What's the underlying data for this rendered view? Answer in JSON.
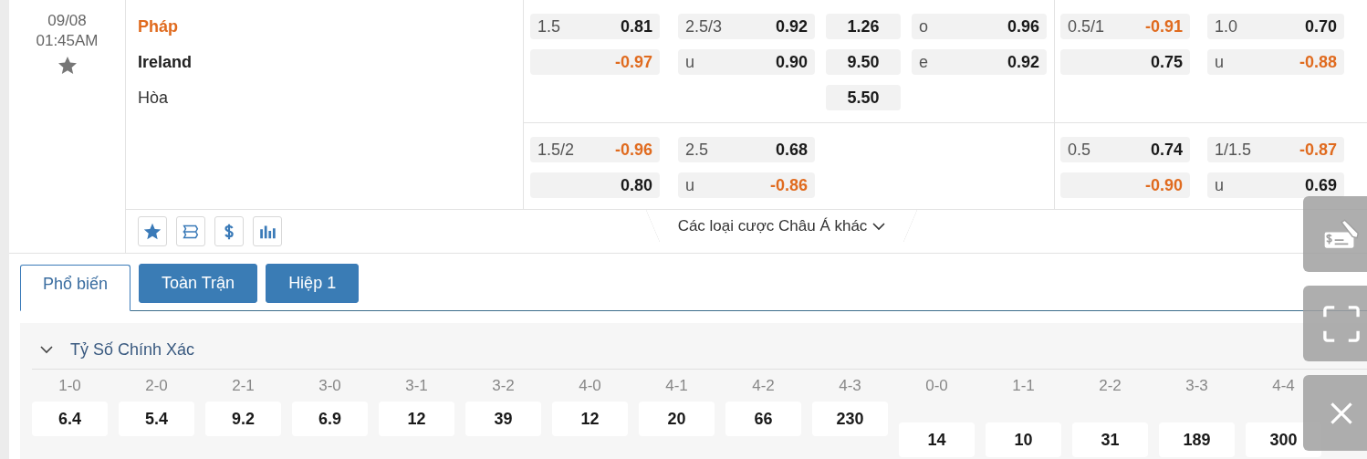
{
  "match": {
    "date": "09/08",
    "time": "01:45AM",
    "favorite": false,
    "teams": [
      {
        "name": "Pháp",
        "favored": true
      },
      {
        "name": "Ireland",
        "favored": false
      }
    ],
    "draw_label": "Hòa"
  },
  "odds_groups": [
    {
      "rows": [
        {
          "columns": [
            [
              {
                "label": "1.5",
                "value": "0.81",
                "negative": false
              },
              {
                "value": "-0.97",
                "negative": true
              }
            ],
            [
              {
                "label": "2.5/3",
                "value": "0.92",
                "negative": false
              },
              {
                "label": "u",
                "value": "0.90",
                "negative": false
              }
            ],
            [
              {
                "value": "1.26",
                "negative": false
              },
              {
                "value": "9.50",
                "negative": false
              },
              {
                "value": "5.50",
                "negative": false
              }
            ],
            [
              {
                "label": "o",
                "value": "0.96",
                "negative": false
              },
              {
                "label": "e",
                "value": "0.92",
                "negative": false
              }
            ]
          ]
        },
        {
          "columns": [
            [
              {
                "label": "1.5/2",
                "value": "-0.96",
                "negative": true
              },
              {
                "value": "0.80",
                "negative": false
              }
            ],
            [
              {
                "label": "2.5",
                "value": "0.68",
                "negative": false
              },
              {
                "label": "u",
                "value": "-0.86",
                "negative": true
              }
            ]
          ]
        }
      ]
    },
    {
      "rows": [
        {
          "columns": [
            [
              {
                "label": "0.5/1",
                "value": "-0.91",
                "negative": true
              },
              {
                "value": "0.75",
                "negative": false
              }
            ],
            [
              {
                "label": "1.0",
                "value": "0.70",
                "negative": false
              },
              {
                "label": "u",
                "value": "-0.88",
                "negative": true
              }
            ]
          ]
        },
        {
          "columns": [
            [
              {
                "label": "0.5",
                "value": "0.74",
                "negative": false
              },
              {
                "value": "-0.90",
                "negative": true
              }
            ],
            [
              {
                "label": "1/1.5",
                "value": "-0.87",
                "negative": true
              },
              {
                "label": "u",
                "value": "0.69",
                "negative": false
              }
            ]
          ]
        }
      ]
    }
  ],
  "more_bets": "Các loại cược Châu Á khác",
  "tabs": [
    {
      "label": "Phổ biến",
      "selected": true
    },
    {
      "label": "Toàn Trận",
      "selected": false
    },
    {
      "label": "Hiệp 1",
      "selected": false
    }
  ],
  "correct_score": {
    "title": "Tỷ Số Chính Xác",
    "expanded": true,
    "home_wins": [
      {
        "score": "1-0",
        "odds": "6.4"
      },
      {
        "score": "2-0",
        "odds": "5.4"
      },
      {
        "score": "2-1",
        "odds": "9.2"
      },
      {
        "score": "3-0",
        "odds": "6.9"
      },
      {
        "score": "3-1",
        "odds": "12"
      },
      {
        "score": "3-2",
        "odds": "39"
      },
      {
        "score": "4-0",
        "odds": "12"
      },
      {
        "score": "4-1",
        "odds": "20"
      },
      {
        "score": "4-2",
        "odds": "66"
      },
      {
        "score": "4-3",
        "odds": "230"
      }
    ],
    "draws": [
      {
        "score": "0-0",
        "odds": "14"
      },
      {
        "score": "1-1",
        "odds": "10"
      },
      {
        "score": "2-2",
        "odds": "31"
      },
      {
        "score": "3-3",
        "odds": "189"
      },
      {
        "score": "4-4",
        "odds": "300"
      }
    ]
  }
}
